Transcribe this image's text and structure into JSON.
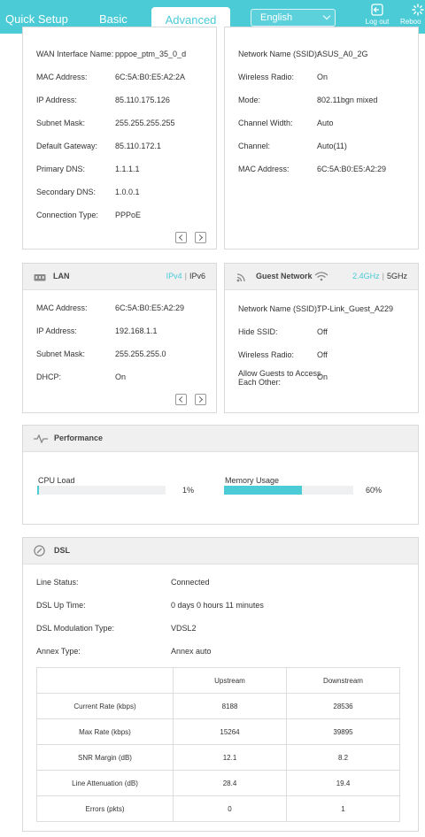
{
  "nav": {
    "quick_setup": "Quick Setup",
    "basic": "Basic",
    "advanced": "Advanced",
    "language": "English",
    "logout": "Log out",
    "reboot": "Reboo"
  },
  "internet": {
    "rows": [
      {
        "label": "WAN Interface Name:",
        "value": "pppoe_ptm_35_0_d"
      },
      {
        "label": "MAC Address:",
        "value": "6C:5A:B0:E5:A2:2A"
      },
      {
        "label": "IP Address:",
        "value": "85.110.175.126"
      },
      {
        "label": "Subnet Mask:",
        "value": "255.255.255.255"
      },
      {
        "label": "Default Gateway:",
        "value": "85.110.172.1"
      },
      {
        "label": "Primary DNS:",
        "value": "1.1.1.1"
      },
      {
        "label": "Secondary DNS:",
        "value": "1.0.0.1"
      },
      {
        "label": "Connection Type:",
        "value": "PPPoE"
      }
    ]
  },
  "wireless": {
    "rows": [
      {
        "label": "Network Name (SSID):",
        "value": "ASUS_A0_2G"
      },
      {
        "label": "Wireless Radio:",
        "value": "On"
      },
      {
        "label": "Mode:",
        "value": "802.11bgn mixed"
      },
      {
        "label": "Channel Width:",
        "value": "Auto"
      },
      {
        "label": "Channel:",
        "value": "Auto(11)"
      },
      {
        "label": "MAC Address:",
        "value": "6C:5A:B0:E5:A2:29"
      }
    ]
  },
  "lan": {
    "title": "LAN",
    "ipv4": "IPv4",
    "sep": "|",
    "ipv6": "IPv6",
    "rows": [
      {
        "label": "MAC Address:",
        "value": "6C:5A:B0:E5:A2:29"
      },
      {
        "label": "IP Address:",
        "value": "192.168.1.1"
      },
      {
        "label": "Subnet Mask:",
        "value": "255.255.255.0"
      },
      {
        "label": "DHCP:",
        "value": "On"
      }
    ]
  },
  "guest": {
    "title": "Guest Network",
    "band24": "2.4GHz",
    "sep": "|",
    "band5": "5GHz",
    "rows": [
      {
        "label": "Network Name (SSID):",
        "value": "TP-Link_Guest_A229"
      },
      {
        "label": "Hide SSID:",
        "value": "Off"
      },
      {
        "label": "Wireless Radio:",
        "value": "Off"
      },
      {
        "label_line1": "Allow Guests to Access",
        "label_line2": "Each Other:",
        "value": "On"
      }
    ]
  },
  "performance": {
    "title": "Performance",
    "cpu_label": "CPU Load",
    "cpu_value": "1%",
    "cpu_fraction": 0.01,
    "mem_label": "Memory Usage",
    "mem_value": "60%",
    "mem_fraction": 0.6
  },
  "dsl": {
    "title": "DSL",
    "rows": [
      {
        "label": "Line Status:",
        "value": "Connected"
      },
      {
        "label": "DSL Up Time:",
        "value": "0 days 0 hours 11 minutes"
      },
      {
        "label": "DSL Modulation Type:",
        "value": "VDSL2"
      },
      {
        "label": "Annex Type:",
        "value": "Annex auto"
      }
    ],
    "table": {
      "headers": [
        "",
        "Upstream",
        "Downstream"
      ],
      "rows": [
        [
          "Current Rate (kbps)",
          "8188",
          "28536"
        ],
        [
          "Max Rate (kbps)",
          "15264",
          "39895"
        ],
        [
          "SNR Margin (dB)",
          "12.1",
          "8.2"
        ],
        [
          "Line Attenuation (dB)",
          "28.4",
          "19.4"
        ],
        [
          "Errors (pkts)",
          "0",
          "1"
        ]
      ]
    }
  },
  "colors": {
    "accent": "#4acbd6",
    "bar_track": "#eef0f1",
    "card_border": "#d9d9d9"
  }
}
